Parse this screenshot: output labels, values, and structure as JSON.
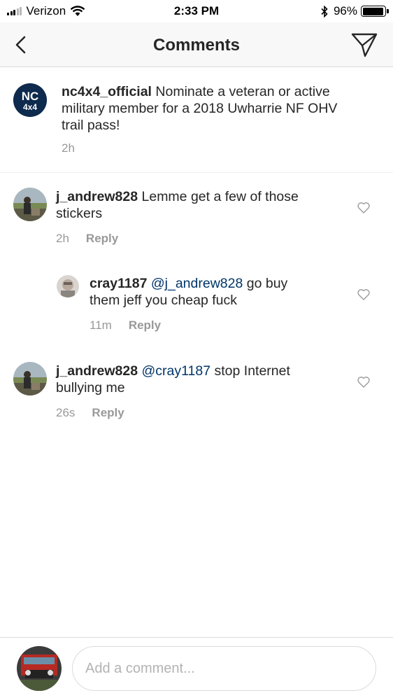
{
  "status_bar": {
    "carrier": "Verizon",
    "time": "2:33 PM",
    "battery_percent": "96%",
    "battery_level": 0.96
  },
  "nav": {
    "title": "Comments",
    "back_icon": "chevron-left-icon",
    "send_icon": "paper-plane-icon"
  },
  "caption": {
    "username": "nc4x4_official",
    "text": "Nominate a veteran or active military member for a 2018 Uwharrie NF OHV trail pass!",
    "time": "2h",
    "avatar_text_top": "NC",
    "avatar_text_bottom": "4x4"
  },
  "comments": [
    {
      "username": "j_andrew828",
      "mention": "",
      "text": "Lemme get a few of those stickers",
      "time": "2h",
      "reply_label": "Reply"
    },
    {
      "username": "cray1187",
      "mention": "@j_andrew828",
      "text": "go buy them jeff you cheap fuck",
      "time": "11m",
      "reply_label": "Reply"
    },
    {
      "username": "j_andrew828",
      "mention": "@cray1187",
      "text": "stop Internet bullying me",
      "time": "26s",
      "reply_label": "Reply"
    }
  ],
  "input": {
    "placeholder": "Add a comment..."
  },
  "colors": {
    "mention": "#003569",
    "meta": "#999999",
    "text": "#262626",
    "nav_background": "#f8f8f8"
  }
}
